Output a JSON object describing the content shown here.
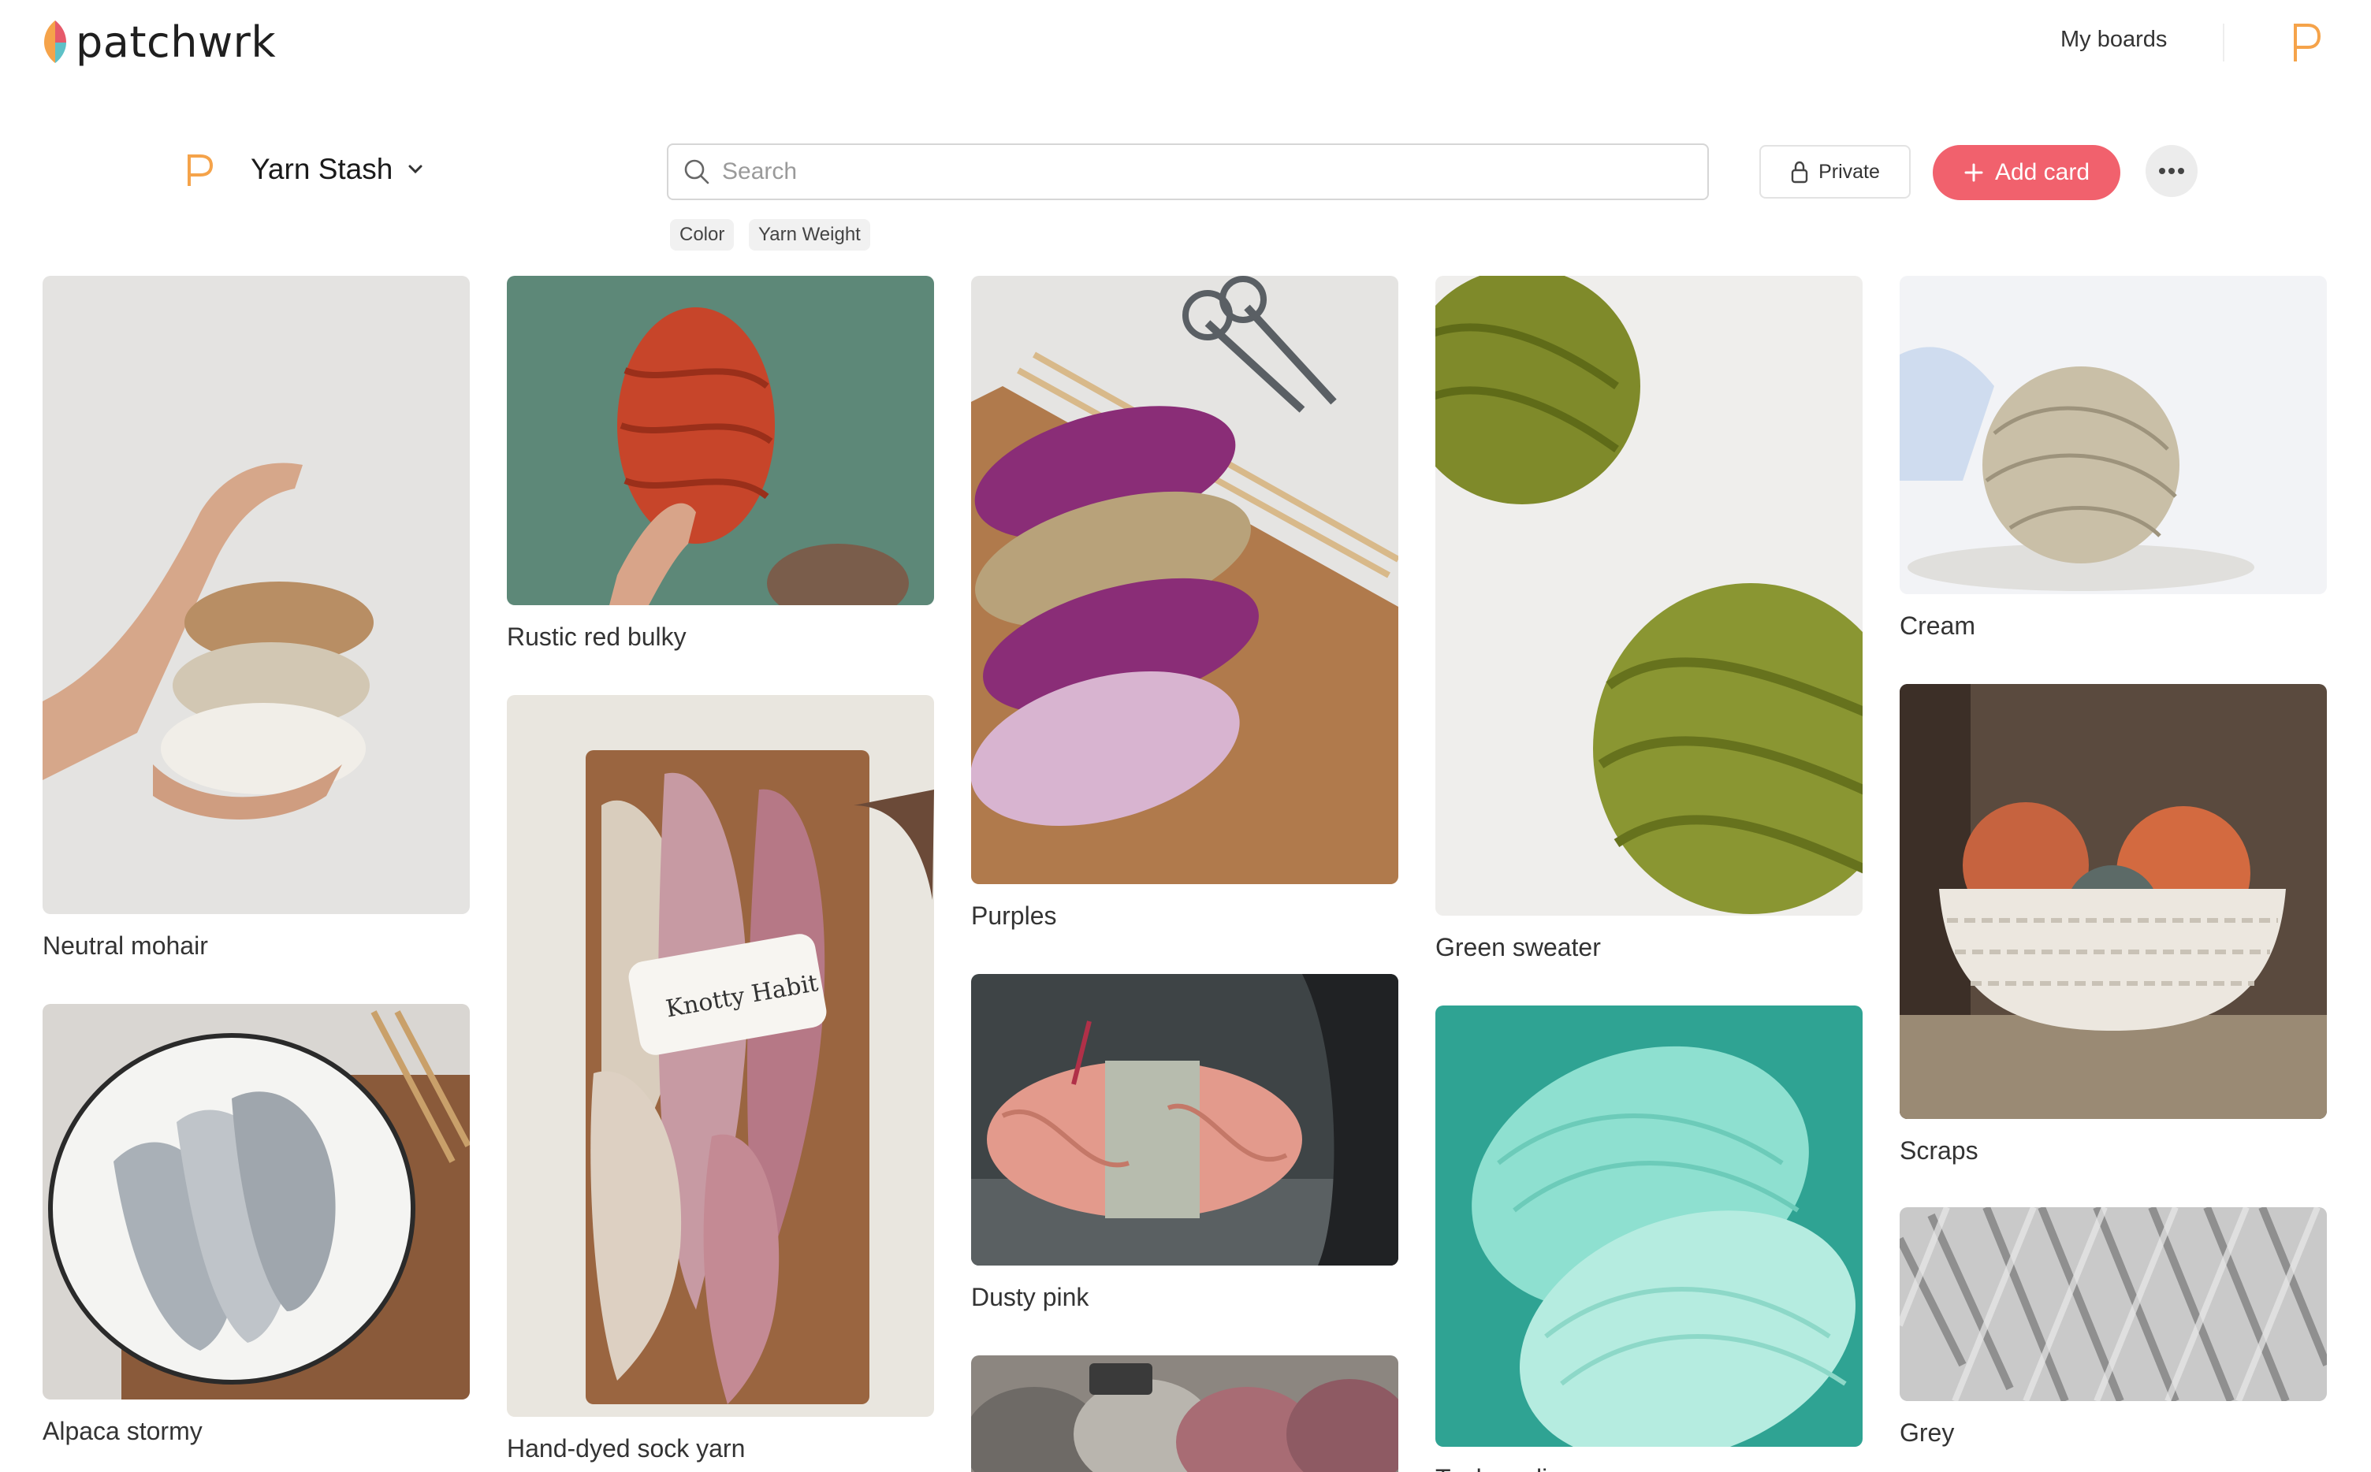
{
  "app": {
    "name": "patchwrk"
  },
  "header": {
    "my_boards": "My boards",
    "user_initial": "P"
  },
  "board": {
    "icon_letter": "P",
    "title": "Yarn Stash"
  },
  "search": {
    "placeholder": "Search"
  },
  "filters": [
    "Color",
    "Yarn Weight"
  ],
  "actions": {
    "private_label": "Private",
    "add_card_label": "Add card"
  },
  "colors": {
    "accent": "#f1616d",
    "brand_orange": "#f5a34a",
    "chip_bg": "#f1f1f1"
  },
  "cards": [
    {
      "title": "Neutral mohair"
    },
    {
      "title": "Alpaca stormy"
    },
    {
      "title": "Rustic red bulky"
    },
    {
      "title": "Hand-dyed sock yarn"
    },
    {
      "title": "Purples"
    },
    {
      "title": "Dusty pink"
    },
    {
      "title": ""
    },
    {
      "title": "Green sweater"
    },
    {
      "title": "Teal acrylic"
    },
    {
      "title": "Cream"
    },
    {
      "title": "Scraps"
    },
    {
      "title": "Grey"
    }
  ]
}
